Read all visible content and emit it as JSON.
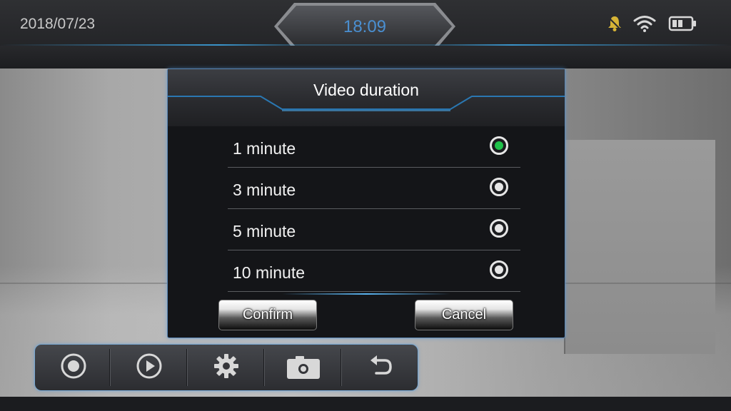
{
  "status_bar": {
    "date": "2018/07/23",
    "time": "18:09",
    "icons": [
      "mute-bell-icon",
      "wifi-icon",
      "battery-icon"
    ]
  },
  "dialog": {
    "title": "Video duration",
    "options": [
      {
        "label": "1 minute",
        "selected": true
      },
      {
        "label": "3 minute",
        "selected": false
      },
      {
        "label": "5 minute",
        "selected": false
      },
      {
        "label": "10 minute",
        "selected": false
      }
    ],
    "confirm_label": "Confirm",
    "cancel_label": "Cancel"
  },
  "toolbar": {
    "buttons": [
      "record-icon",
      "play-icon",
      "gear-icon",
      "camera-icon",
      "back-icon"
    ]
  },
  "colors": {
    "accent": "#4a8fd1",
    "selected_radio": "#1fc24a",
    "bell": "#d6b436"
  }
}
